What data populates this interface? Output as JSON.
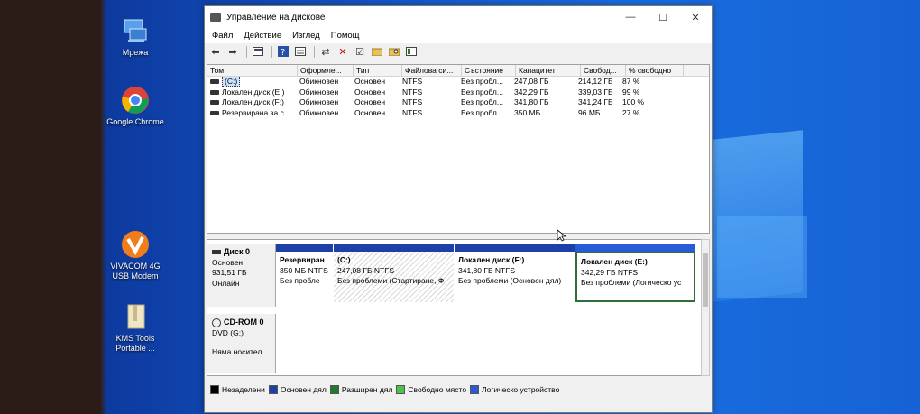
{
  "desktop": {
    "icons": [
      {
        "label": "Мрежа"
      },
      {
        "label": "Google Chrome"
      },
      {
        "label": "VIVACOM 4G USB Modem"
      },
      {
        "label": "KMS Tools Portable ..."
      }
    ]
  },
  "window": {
    "title": "Управление на дискове",
    "controls": {
      "minimize": "—",
      "maximize": "☐",
      "close": "✕"
    }
  },
  "menu": [
    "Файл",
    "Действие",
    "Изглед",
    "Помощ"
  ],
  "volumes": {
    "headers": [
      "Том",
      "Оформле...",
      "Тип",
      "Файлова си...",
      "Състояние",
      "Капацитет",
      "Свобод...",
      "% свободно"
    ],
    "rows": [
      [
        "(C:)",
        "Обикновен",
        "Основен",
        "NTFS",
        "Без пробл...",
        "247,08 ГБ",
        "214,12 ГБ",
        "87 %"
      ],
      [
        "Локален диск (E:)",
        "Обикновен",
        "Основен",
        "NTFS",
        "Без пробл...",
        "342,29 ГБ",
        "339,03 ГБ",
        "99 %"
      ],
      [
        "Локален диск (F:)",
        "Обикновен",
        "Основен",
        "NTFS",
        "Без пробл...",
        "341,80 ГБ",
        "341,24 ГБ",
        "100 %"
      ],
      [
        "Резервирана за с...",
        "Обикновен",
        "Основен",
        "NTFS",
        "Без пробл...",
        "350 МБ",
        "96 МБ",
        "27 %"
      ]
    ]
  },
  "disk0": {
    "name": "Диск 0",
    "type": "Основен",
    "size": "931,51 ГБ",
    "status": "Онлайн",
    "partitions": [
      {
        "title": "Резервиран",
        "size": "350 МБ NTFS",
        "status": "Без пробле"
      },
      {
        "title": "(C:)",
        "size": "247,08 ГБ NTFS",
        "status": "Без проблеми (Стартиране, Ф"
      },
      {
        "title": "Локален диск  (F:)",
        "size": "341,80 ГБ NTFS",
        "status": "Без проблеми (Основен дял)"
      },
      {
        "title": "Локален диск  (E:)",
        "size": "342,29 ГБ NTFS",
        "status": "Без проблеми (Логическо ус"
      }
    ]
  },
  "cdrom": {
    "name": "CD-ROM 0",
    "type": "DVD (G:)",
    "status": "Няма носител"
  },
  "legend": [
    {
      "label": "Незаделени",
      "color": "#000000"
    },
    {
      "label": "Основен дял",
      "color": "#1c3fa8"
    },
    {
      "label": "Разширен дял",
      "color": "#1f7a2e"
    },
    {
      "label": "Свободно място",
      "color": "#4cc24c"
    },
    {
      "label": "Логическо устройство",
      "color": "#2a5bd7"
    }
  ]
}
